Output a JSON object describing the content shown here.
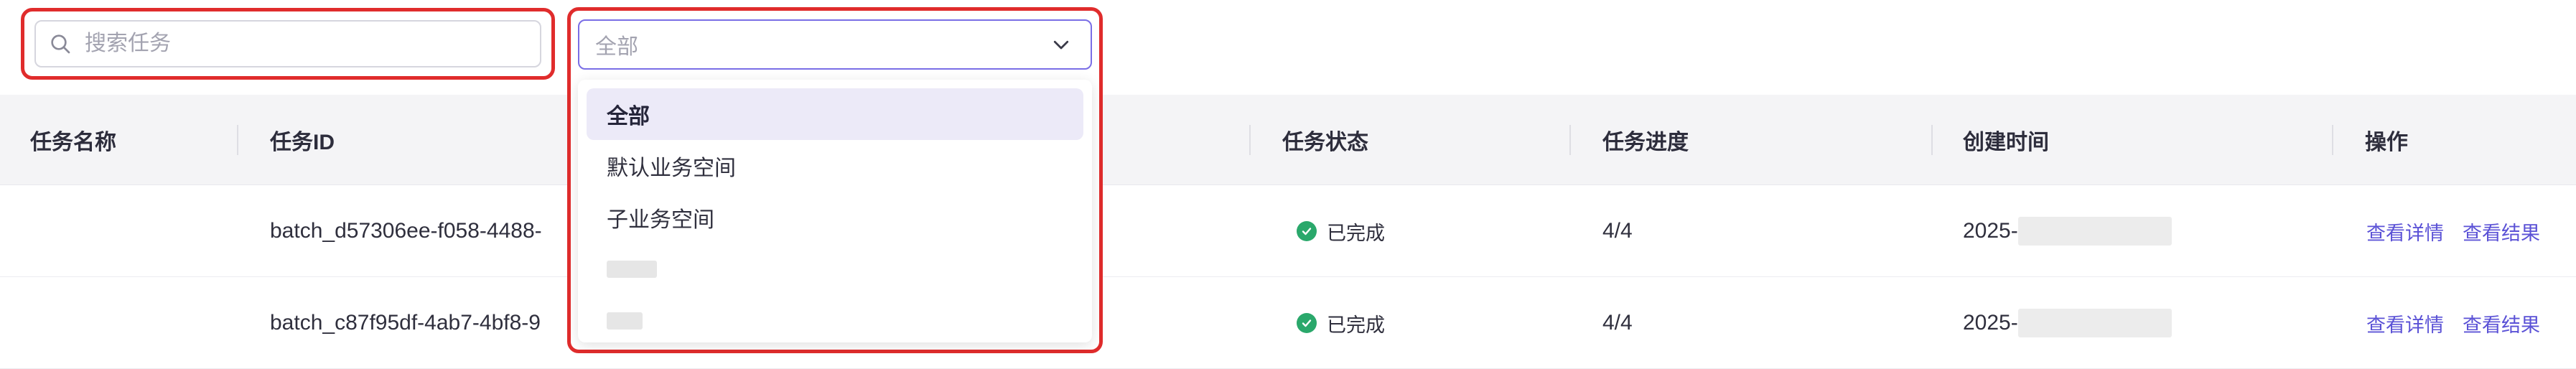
{
  "search": {
    "placeholder": "搜索任务"
  },
  "filter": {
    "selected": "全部",
    "options": [
      {
        "label": "全部",
        "active": true
      },
      {
        "label": "默认业务空间"
      },
      {
        "label": "子业务空间"
      },
      {
        "label": ""
      },
      {
        "label": ""
      }
    ]
  },
  "table": {
    "headers": {
      "name": "任务名称",
      "id": "任务ID",
      "status": "任务状态",
      "progress": "任务进度",
      "created": "创建时间",
      "actions": "操作"
    },
    "rows": [
      {
        "name": "",
        "id": "batch_d57306ee-f058-4488-",
        "status": "已完成",
        "progress": "4/4",
        "created": "2025-",
        "detail_link": "查看详情",
        "result_link": "查看结果"
      },
      {
        "name": "",
        "id": "batch_c87f95df-4ab7-4bf8-9",
        "status": "已完成",
        "progress": "4/4",
        "created": "2025-",
        "detail_link": "查看详情",
        "result_link": "查看结果"
      }
    ]
  },
  "colors": {
    "accent": "#5b52d6",
    "success": "#2aa86b",
    "highlight": "#e02c2c"
  }
}
